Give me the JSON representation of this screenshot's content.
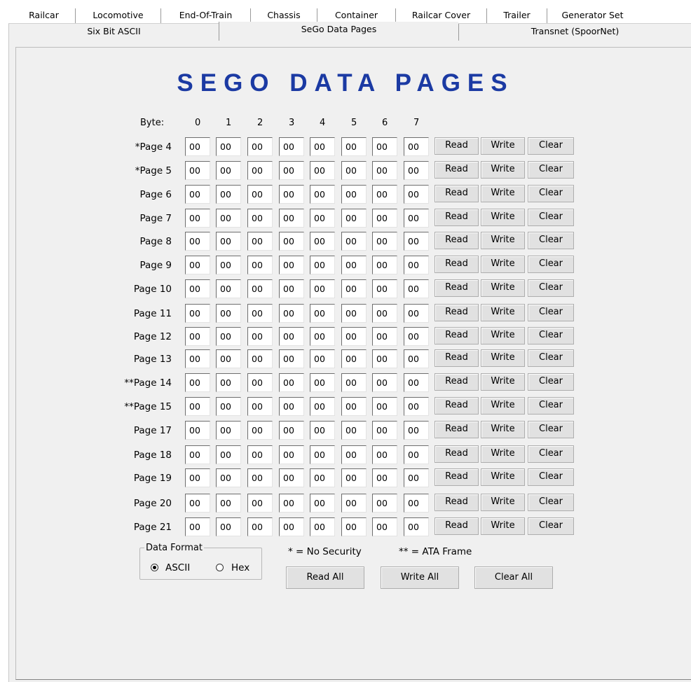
{
  "tabs_row1": [
    "Railcar",
    "Locomotive",
    "End-Of-Train",
    "Chassis",
    "Container",
    "Railcar Cover",
    "Trailer",
    "Generator Set"
  ],
  "tabs_row2": [
    "Six Bit ASCII",
    "SeGo Data Pages",
    "Transnet (SpoorNet)"
  ],
  "active_tab": "SeGo Data Pages",
  "title": "SEGO DATA PAGES",
  "byte_label": "Byte:",
  "byte_indices": [
    "0",
    "1",
    "2",
    "3",
    "4",
    "5",
    "6",
    "7"
  ],
  "rows": [
    {
      "label": "*Page 4",
      "values": [
        "00",
        "00",
        "00",
        "00",
        "00",
        "00",
        "00",
        "00"
      ]
    },
    {
      "label": "*Page 5",
      "values": [
        "00",
        "00",
        "00",
        "00",
        "00",
        "00",
        "00",
        "00"
      ]
    },
    {
      "label": "Page 6",
      "values": [
        "00",
        "00",
        "00",
        "00",
        "00",
        "00",
        "00",
        "00"
      ]
    },
    {
      "label": "Page 7",
      "values": [
        "00",
        "00",
        "00",
        "00",
        "00",
        "00",
        "00",
        "00"
      ]
    },
    {
      "label": "Page 8",
      "values": [
        "00",
        "00",
        "00",
        "00",
        "00",
        "00",
        "00",
        "00"
      ]
    },
    {
      "label": "Page 9",
      "values": [
        "00",
        "00",
        "00",
        "00",
        "00",
        "00",
        "00",
        "00"
      ]
    },
    {
      "label": "Page 10",
      "values": [
        "00",
        "00",
        "00",
        "00",
        "00",
        "00",
        "00",
        "00"
      ]
    },
    {
      "label": "Page 11",
      "values": [
        "00",
        "00",
        "00",
        "00",
        "00",
        "00",
        "00",
        "00"
      ]
    },
    {
      "label": "Page 12",
      "values": [
        "00",
        "00",
        "00",
        "00",
        "00",
        "00",
        "00",
        "00"
      ]
    },
    {
      "label": "Page 13",
      "values": [
        "00",
        "00",
        "00",
        "00",
        "00",
        "00",
        "00",
        "00"
      ]
    },
    {
      "label": "**Page 14",
      "values": [
        "00",
        "00",
        "00",
        "00",
        "00",
        "00",
        "00",
        "00"
      ]
    },
    {
      "label": "**Page 15",
      "values": [
        "00",
        "00",
        "00",
        "00",
        "00",
        "00",
        "00",
        "00"
      ]
    },
    {
      "label": "Page 17",
      "values": [
        "00",
        "00",
        "00",
        "00",
        "00",
        "00",
        "00",
        "00"
      ]
    },
    {
      "label": "Page 18",
      "values": [
        "00",
        "00",
        "00",
        "00",
        "00",
        "00",
        "00",
        "00"
      ]
    },
    {
      "label": "Page 19",
      "values": [
        "00",
        "00",
        "00",
        "00",
        "00",
        "00",
        "00",
        "00"
      ]
    },
    {
      "label": "Page 20",
      "values": [
        "00",
        "00",
        "00",
        "00",
        "00",
        "00",
        "00",
        "00"
      ]
    },
    {
      "label": "Page 21",
      "values": [
        "00",
        "00",
        "00",
        "00",
        "00",
        "00",
        "00",
        "00"
      ]
    }
  ],
  "row_buttons": {
    "read": "Read",
    "write": "Write",
    "clear": "Clear"
  },
  "data_format": {
    "legend": "Data Format",
    "ascii": "ASCII",
    "hex": "Hex",
    "selected": "ASCII"
  },
  "notes": {
    "no_security": "* = No Security",
    "ata_frame": "** = ATA Frame"
  },
  "bottom_buttons": {
    "read_all": "Read All",
    "write_all": "Write All",
    "clear_all": "Clear All"
  }
}
